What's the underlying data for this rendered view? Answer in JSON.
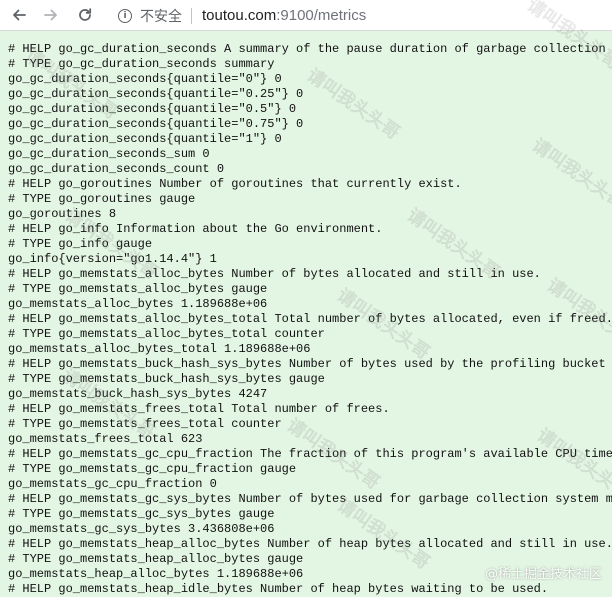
{
  "browser": {
    "security_label": "不安全",
    "url_host": "toutou.com",
    "url_rest": ":9100/metrics"
  },
  "watermark": {
    "text": "请叫我头头哥",
    "footer": "@稀土掘金技术社区"
  },
  "metrics_lines": [
    "# HELP go_gc_duration_seconds A summary of the pause duration of garbage collection cycles.",
    "# TYPE go_gc_duration_seconds summary",
    "go_gc_duration_seconds{quantile=\"0\"} 0",
    "go_gc_duration_seconds{quantile=\"0.25\"} 0",
    "go_gc_duration_seconds{quantile=\"0.5\"} 0",
    "go_gc_duration_seconds{quantile=\"0.75\"} 0",
    "go_gc_duration_seconds{quantile=\"1\"} 0",
    "go_gc_duration_seconds_sum 0",
    "go_gc_duration_seconds_count 0",
    "# HELP go_goroutines Number of goroutines that currently exist.",
    "# TYPE go_goroutines gauge",
    "go_goroutines 8",
    "# HELP go_info Information about the Go environment.",
    "# TYPE go_info gauge",
    "go_info{version=\"go1.14.4\"} 1",
    "# HELP go_memstats_alloc_bytes Number of bytes allocated and still in use.",
    "# TYPE go_memstats_alloc_bytes gauge",
    "go_memstats_alloc_bytes 1.189688e+06",
    "# HELP go_memstats_alloc_bytes_total Total number of bytes allocated, even if freed.",
    "# TYPE go_memstats_alloc_bytes_total counter",
    "go_memstats_alloc_bytes_total 1.189688e+06",
    "# HELP go_memstats_buck_hash_sys_bytes Number of bytes used by the profiling bucket hash table.",
    "# TYPE go_memstats_buck_hash_sys_bytes gauge",
    "go_memstats_buck_hash_sys_bytes 4247",
    "# HELP go_memstats_frees_total Total number of frees.",
    "# TYPE go_memstats_frees_total counter",
    "go_memstats_frees_total 623",
    "# HELP go_memstats_gc_cpu_fraction The fraction of this program's available CPU time used by the GC since the program started.",
    "# TYPE go_memstats_gc_cpu_fraction gauge",
    "go_memstats_gc_cpu_fraction 0",
    "# HELP go_memstats_gc_sys_bytes Number of bytes used for garbage collection system metadata.",
    "# TYPE go_memstats_gc_sys_bytes gauge",
    "go_memstats_gc_sys_bytes 3.436808e+06",
    "# HELP go_memstats_heap_alloc_bytes Number of heap bytes allocated and still in use.",
    "# TYPE go_memstats_heap_alloc_bytes gauge",
    "go_memstats_heap_alloc_bytes 1.189688e+06",
    "# HELP go_memstats_heap_idle_bytes Number of heap bytes waiting to be used."
  ]
}
